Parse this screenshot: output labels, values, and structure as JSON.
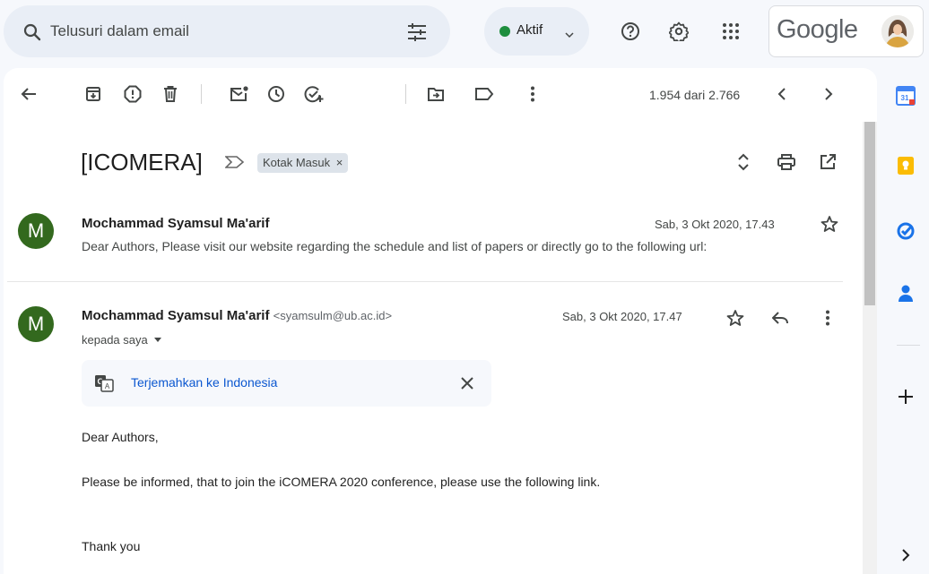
{
  "search": {
    "placeholder": "Telusuri dalam email",
    "icon": "search-icon",
    "filter_icon": "tune-icon"
  },
  "status": {
    "label": "Aktif",
    "color": "#1e8e3e"
  },
  "header": {
    "logo_text": "Google",
    "icons": [
      "help-icon",
      "settings-icon",
      "apps-icon"
    ]
  },
  "toolbar": {
    "icons": [
      "back-arrow-icon",
      "archive-icon",
      "report-spam-icon",
      "delete-icon",
      "mark-unread-icon",
      "snooze-icon",
      "add-task-icon",
      "move-to-icon",
      "label-icon",
      "more-icon"
    ],
    "count": "1.954 dari 2.766"
  },
  "thread": {
    "subject": "[ICOMERA]",
    "label": "Kotak Masuk",
    "label_close": "×"
  },
  "messages": [
    {
      "avatar": "M",
      "sender": "Mochammad Syamsul Ma'arif",
      "date": "Sab, 3 Okt 2020, 17.43",
      "snippet": "Dear Authors, Please visit our website regarding the schedule and list of papers or directly go to the following url:"
    },
    {
      "avatar": "M",
      "sender": "Mochammad Syamsul Ma'arif",
      "email": "<syamsulm@ub.ac.id>",
      "date": "Sab, 3 Okt 2020, 17.47",
      "to": "kepada saya",
      "translate": "Terjemahkan ke Indonesia",
      "body": [
        "Dear Authors,",
        "Please be informed, that to join the iCOMERA 2020 conference, please use the following link.",
        "Thank you"
      ]
    }
  ],
  "side_panel": {
    "icons": [
      "calendar-icon",
      "keep-icon",
      "tasks-icon",
      "contacts-icon",
      "add-icon",
      "expand-icon"
    ],
    "calendar_day": "31"
  },
  "colors": {
    "accent": "#0b57d0",
    "avatar_bg": "#33691e",
    "bg": "#f6f8fc"
  }
}
